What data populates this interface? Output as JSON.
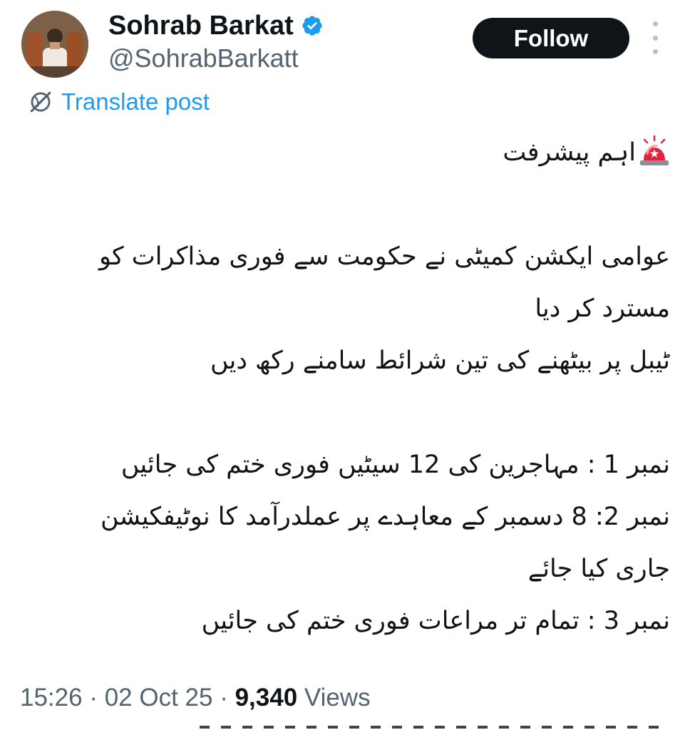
{
  "author": {
    "display_name": "Sohrab Barkat",
    "handle": "@SohrabBarkatt",
    "verified": true
  },
  "actions": {
    "follow_label": "Follow"
  },
  "translate": {
    "label": "Translate post"
  },
  "post": {
    "lines": [
      "اہم پیشرفت",
      "",
      "عوامی ایکشن کمیٹی نے حکومت سے فوری مذاکرات کو",
      "مسترد کر دیا",
      "ٹیبل پر بیٹھنے کی تین شرائط سامنے رکھ دیں",
      "",
      "نمبر 1 : مہاجرین کی 12 سیٹیں فوری ختم کی جائیں",
      "نمبر 2: 8 دسمبر کے معاہدے پر عملدرآمد کا نوٹیفکیشن",
      "جاری کیا جائے",
      "نمبر 3 : تمام تر مراعات فوری ختم کی جائیں"
    ]
  },
  "meta": {
    "time": "15:26",
    "separator": " · ",
    "date": "02 Oct 25",
    "views_count": "9,340",
    "views_label": "Views"
  },
  "icons": {
    "verified": "verified-badge-icon",
    "more": "more-options-icon",
    "translate": "translate-globe-icon",
    "siren": "police-light-emoji"
  },
  "colors": {
    "accent_blue": "#1d9bf0",
    "text_primary": "#0f1419",
    "text_secondary": "#536471",
    "follow_button_bg": "#0f1419",
    "follow_button_text": "#ffffff"
  }
}
